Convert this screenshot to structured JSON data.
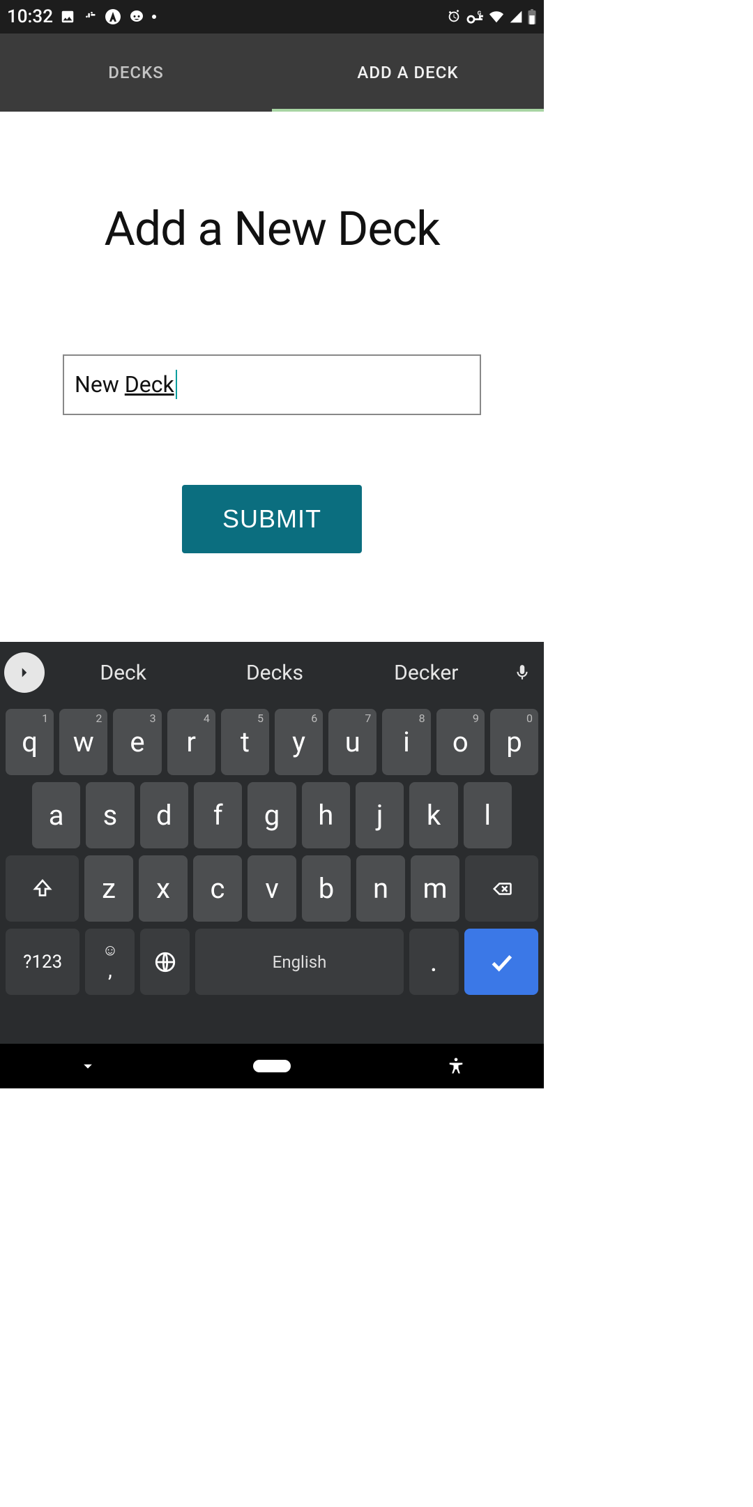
{
  "status": {
    "time": "10:32"
  },
  "tabs": {
    "decks": "DECKS",
    "add": "ADD A DECK"
  },
  "form": {
    "title": "Add a New Deck",
    "value_plain": "New ",
    "value_underlined": "Deck",
    "submit": "SUBMIT"
  },
  "kb": {
    "suggestions": [
      "Deck",
      "Decks",
      "Decker"
    ],
    "row1": [
      {
        "k": "q",
        "s": "1"
      },
      {
        "k": "w",
        "s": "2"
      },
      {
        "k": "e",
        "s": "3"
      },
      {
        "k": "r",
        "s": "4"
      },
      {
        "k": "t",
        "s": "5"
      },
      {
        "k": "y",
        "s": "6"
      },
      {
        "k": "u",
        "s": "7"
      },
      {
        "k": "i",
        "s": "8"
      },
      {
        "k": "o",
        "s": "9"
      },
      {
        "k": "p",
        "s": "0"
      }
    ],
    "row2": [
      "a",
      "s",
      "d",
      "f",
      "g",
      "h",
      "j",
      "k",
      "l"
    ],
    "row3": [
      "z",
      "x",
      "c",
      "v",
      "b",
      "n",
      "m"
    ],
    "sym": "?123",
    "space": "English",
    "period": "."
  }
}
